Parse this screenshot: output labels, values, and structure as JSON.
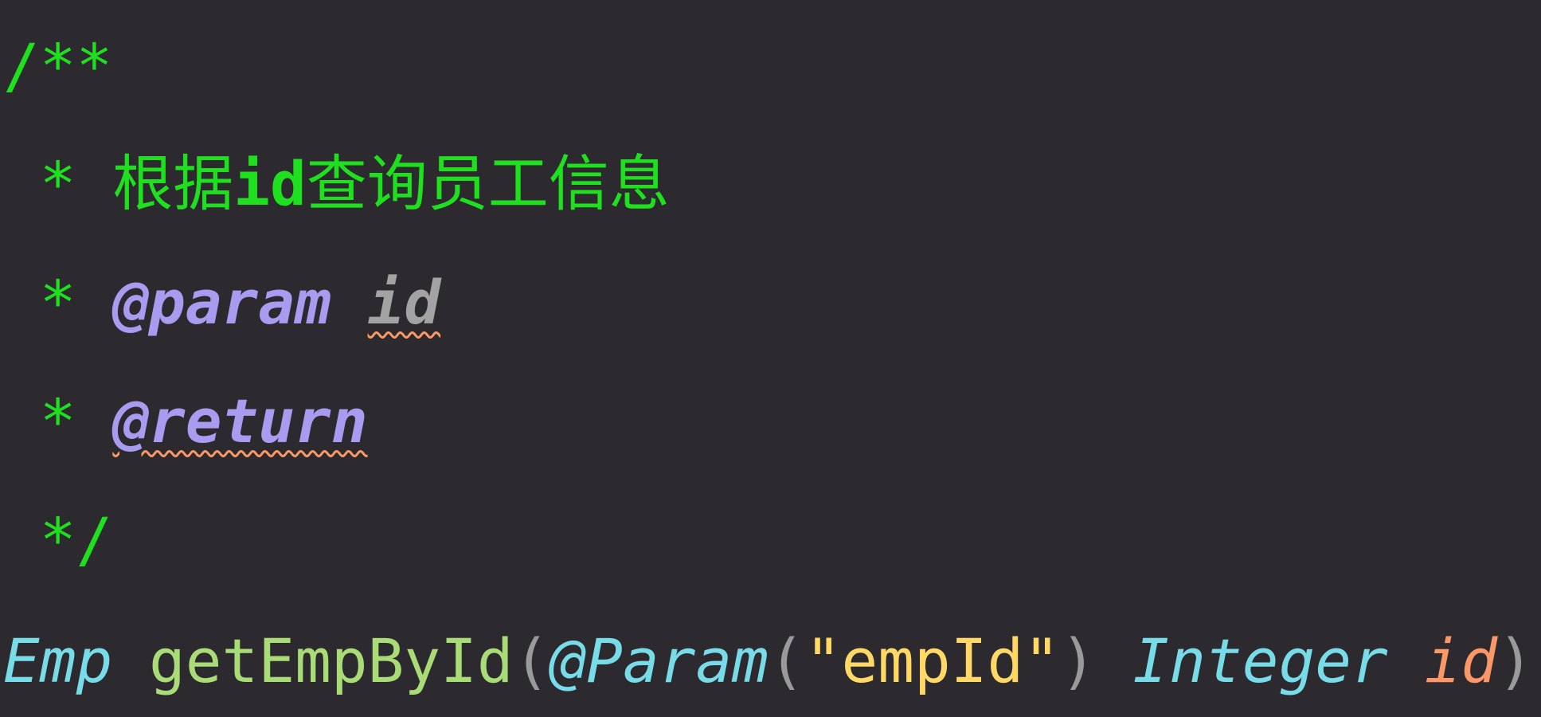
{
  "code": {
    "line1": {
      "comment_open": "/**"
    },
    "line2": {
      "star": " * ",
      "desc_part1": "根据",
      "desc_id": "id",
      "desc_part2": "查询员工信息"
    },
    "line3": {
      "star": " * ",
      "tag": "@param",
      "space": " ",
      "param": "id"
    },
    "line4": {
      "star": " * ",
      "tag": "@return"
    },
    "line5": {
      "comment_close": " */"
    },
    "line6": {
      "return_type": "Emp",
      "space1": " ",
      "method": "getEmpById",
      "paren_open": "(",
      "annotation": "@Param",
      "ann_paren_open": "(",
      "string": "\"empId\"",
      "ann_paren_close": ")",
      "space2": " ",
      "param_type": "Integer",
      "space3": " ",
      "param_name": "id",
      "paren_close": ")",
      "semicolon": ";"
    }
  },
  "colors": {
    "background": "#2c2a2e",
    "comment": "#1fe01f",
    "doc_tag": "#a99bf0",
    "type": "#78dce8",
    "method": "#a9dc76",
    "string": "#ffd866",
    "param": "#fc9867",
    "warning_squiggle": "#fc9867"
  }
}
